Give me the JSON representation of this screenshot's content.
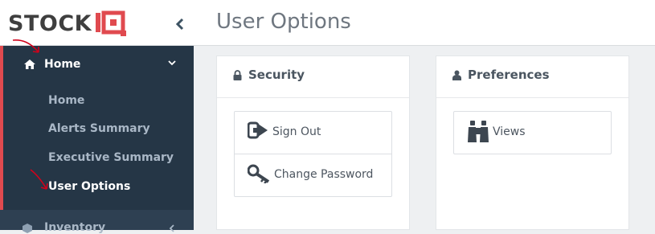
{
  "brand": {
    "name": "STOCK"
  },
  "header": {
    "title": "User Options"
  },
  "sidebar": {
    "group": {
      "label": "Home"
    },
    "items": [
      {
        "label": "Home"
      },
      {
        "label": "Alerts Summary"
      },
      {
        "label": "Executive Summary"
      },
      {
        "label": "User Options",
        "active": true
      }
    ],
    "next_group": {
      "label": "Inventory"
    }
  },
  "panels": {
    "security": {
      "title": "Security",
      "icon": "lock-icon",
      "actions": [
        {
          "label": "Sign Out",
          "icon": "sign-out-icon"
        },
        {
          "label": "Change Password",
          "icon": "key-icon"
        }
      ]
    },
    "preferences": {
      "title": "Preferences",
      "icon": "user-icon",
      "actions": [
        {
          "label": "Views",
          "icon": "binoculars-icon"
        }
      ]
    }
  },
  "colors": {
    "sidebar_bg": "#253646",
    "accent": "#e04a4f",
    "annotation_arrow": "#d0021b"
  }
}
